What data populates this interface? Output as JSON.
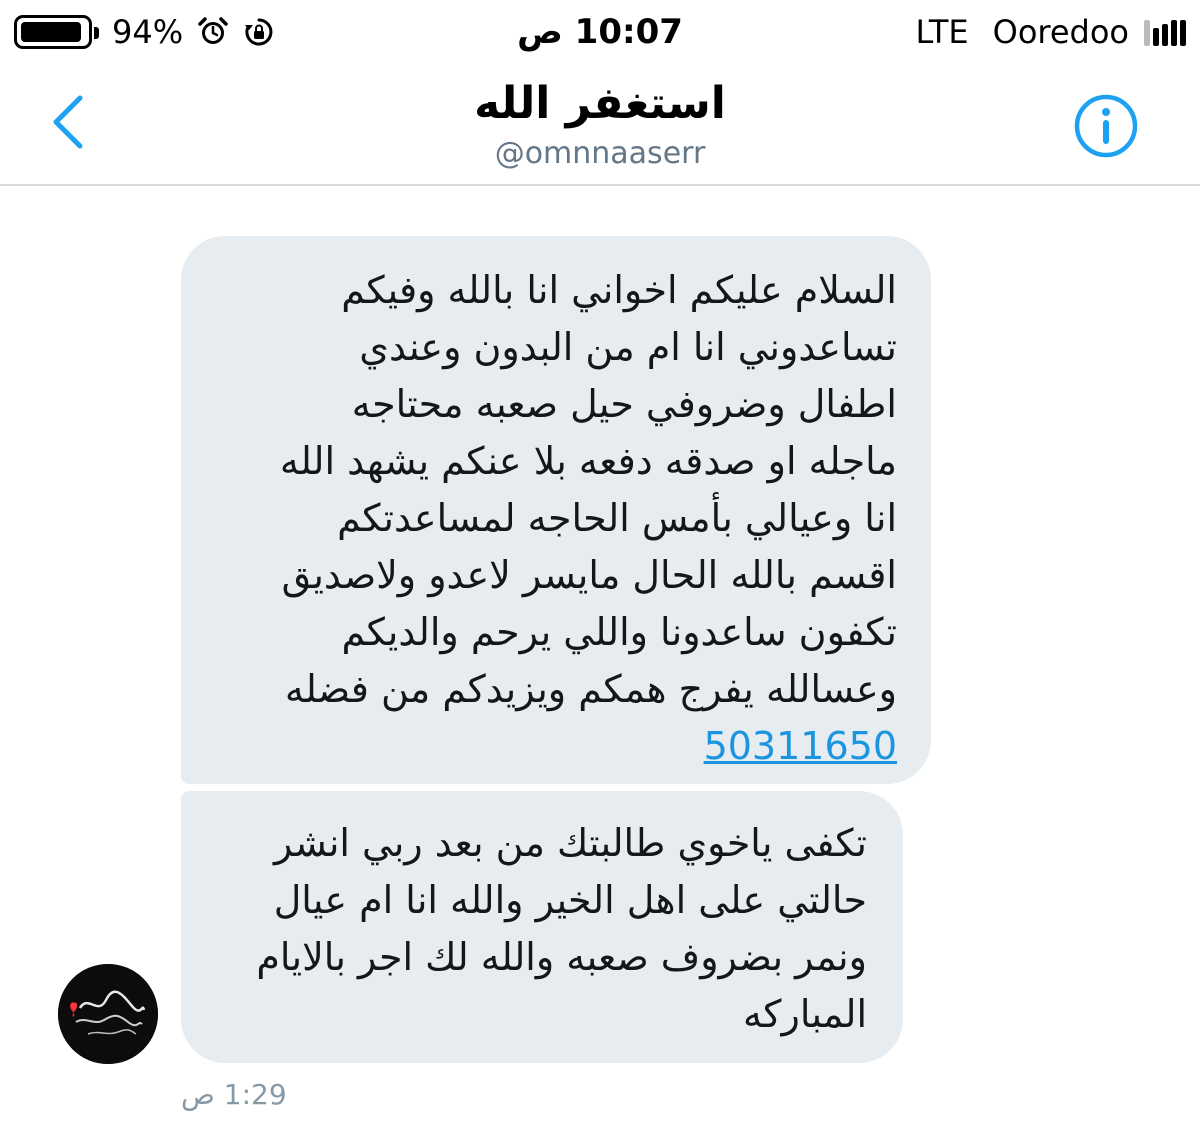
{
  "status_bar": {
    "battery_percent": "94%",
    "battery_level": 0.94,
    "time": "10:07 ص",
    "network": "LTE",
    "carrier": "Ooredoo",
    "icons": [
      "battery-icon",
      "alarm-icon",
      "rotation-lock-icon",
      "signal-icon"
    ]
  },
  "header": {
    "title": "استغفر الله",
    "handle": "@omnnaaserr",
    "icons": [
      "back-chevron-icon",
      "info-icon"
    ],
    "accent_color": "#1da1f2"
  },
  "messages": [
    {
      "lines": [
        "السلام عليكم اخواني انا بالله وفيكم",
        "تساعدوني انا ام من البدون وعندي",
        "اطفال وضروفي حيل صعبه محتاجه",
        "ماجله او صدقه دفعه بلا عنكم يشهد الله",
        "انا وعيالي بأمس الحاجه لمساعدتكم",
        "اقسم بالله الحال مايسر لاعدو ولاصديق",
        "تكفون ساعدونا واللي يرحم والديكم",
        "وعسالله يفرج همكم ويزيدكم من فضله"
      ],
      "phone": "50311650"
    },
    {
      "lines": [
        "تكفى ياخوي طالبتك من بعد ربي انشر",
        "حالتي على اهل الخير والله انا ام عيال",
        "ونمر بضروف صعبه والله لك اجر بالايام",
        "المباركه"
      ]
    }
  ],
  "timestamp": "1:29 ص",
  "colors": {
    "bubble": "#e6ecf0",
    "link": "#1b95e0",
    "muted": "#657786",
    "divider": "#d8dadc"
  }
}
